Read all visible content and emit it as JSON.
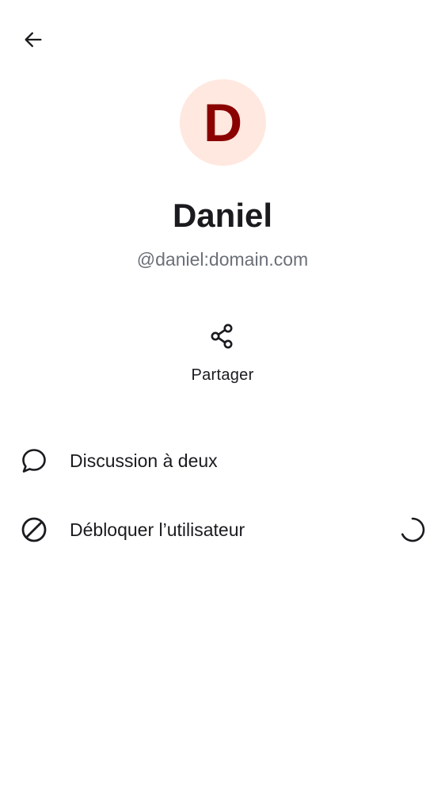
{
  "toolbar": {
    "back_icon": "arrow-left-icon"
  },
  "profile": {
    "avatar_letter": "D",
    "avatar_bg": "#ffe8df",
    "avatar_fg": "#8a0300",
    "display_name": "Daniel",
    "user_id": "@daniel:domain.com"
  },
  "actions": {
    "share": {
      "icon": "share-icon",
      "label": "Partager"
    }
  },
  "list": [
    {
      "icon": "chat-bubble-icon",
      "label": "Discussion à deux"
    },
    {
      "icon": "block-icon",
      "label": "Débloquer l’utilisateur",
      "trailing": "loading-spinner"
    }
  ]
}
